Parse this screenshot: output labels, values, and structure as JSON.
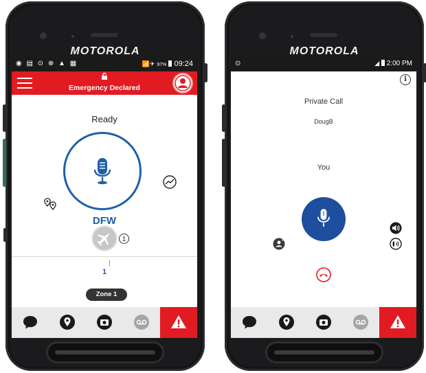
{
  "left_device": {
    "brand": "MOTOROLA",
    "status_bar": {
      "battery": "97%",
      "time": "09:24"
    },
    "header": {
      "title": "Emergency Declared"
    },
    "status": "Ready",
    "channel": "DFW",
    "scan_count": "1",
    "talkgroup_index": "1",
    "zone": "Zone 1",
    "nav_icons": [
      "chat-icon",
      "location-icon",
      "camera-icon",
      "voicemail-icon",
      "emergency-alert-icon"
    ],
    "colors": {
      "accent": "#1e5fa8",
      "emergency": "#e21b22"
    }
  },
  "right_device": {
    "brand": "MOTOROLA",
    "status_bar": {
      "time": "2:00 PM"
    },
    "call_title": "Private Call",
    "contact_name": "DougB",
    "speaker_label": "You",
    "nav_icons": [
      "chat-icon",
      "location-icon",
      "camera-icon",
      "voicemail-icon",
      "emergency-alert-icon"
    ],
    "colors": {
      "accent": "#1e4f9e",
      "emergency": "#e21b22"
    }
  }
}
